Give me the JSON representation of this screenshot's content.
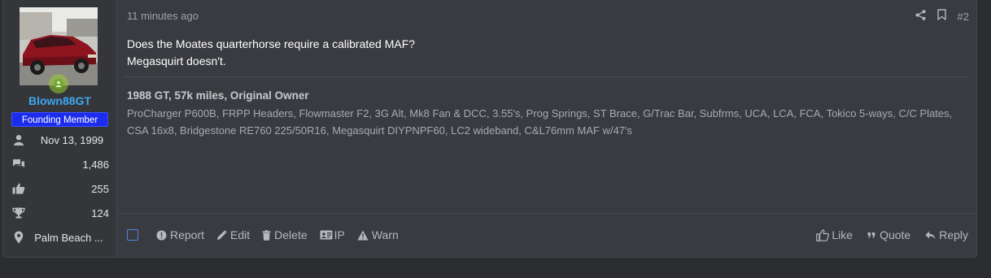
{
  "user": {
    "name": "Blown88GT",
    "banner": "Founding Member",
    "stats": [
      {
        "icon": "user-icon",
        "value": "Nov 13, 1999"
      },
      {
        "icon": "messages-icon",
        "value": "1,486"
      },
      {
        "icon": "thumbs-up-icon",
        "value": "255"
      },
      {
        "icon": "trophy-icon",
        "value": "124"
      },
      {
        "icon": "location-pin-icon",
        "value": "Palm Beach ..."
      }
    ]
  },
  "post": {
    "time": "11 minutes ago",
    "number": "#2",
    "body_line1": "Does the Moates quarterhorse require a calibrated MAF?",
    "body_line2": "Megasquirt doesn't."
  },
  "signature": {
    "title": "1988 GT, 57k miles, Original Owner",
    "text": "ProCharger P600B, FRPP Headers, Flowmaster F2, 3G Alt, Mk8 Fan & DCC, 3.55's, Prog Springs, ST Brace, G/Trac Bar, Subfrms, UCA, LCA, FCA, Tokico 5-ways, C/C Plates, CSA 16x8, Bridgestone RE760 225/50R16, Megasquirt DIYPNPF60, LC2 wideband, C&L76mm MAF w/47's"
  },
  "actions": {
    "report": "Report",
    "edit": "Edit",
    "delete": "Delete",
    "ip": "IP",
    "warn": "Warn",
    "like": "Like",
    "quote": "Quote",
    "reply": "Reply"
  },
  "colors": {
    "username": "#3ea8f0",
    "banner_bg": "#1b2cee",
    "online": "#6fa832"
  }
}
